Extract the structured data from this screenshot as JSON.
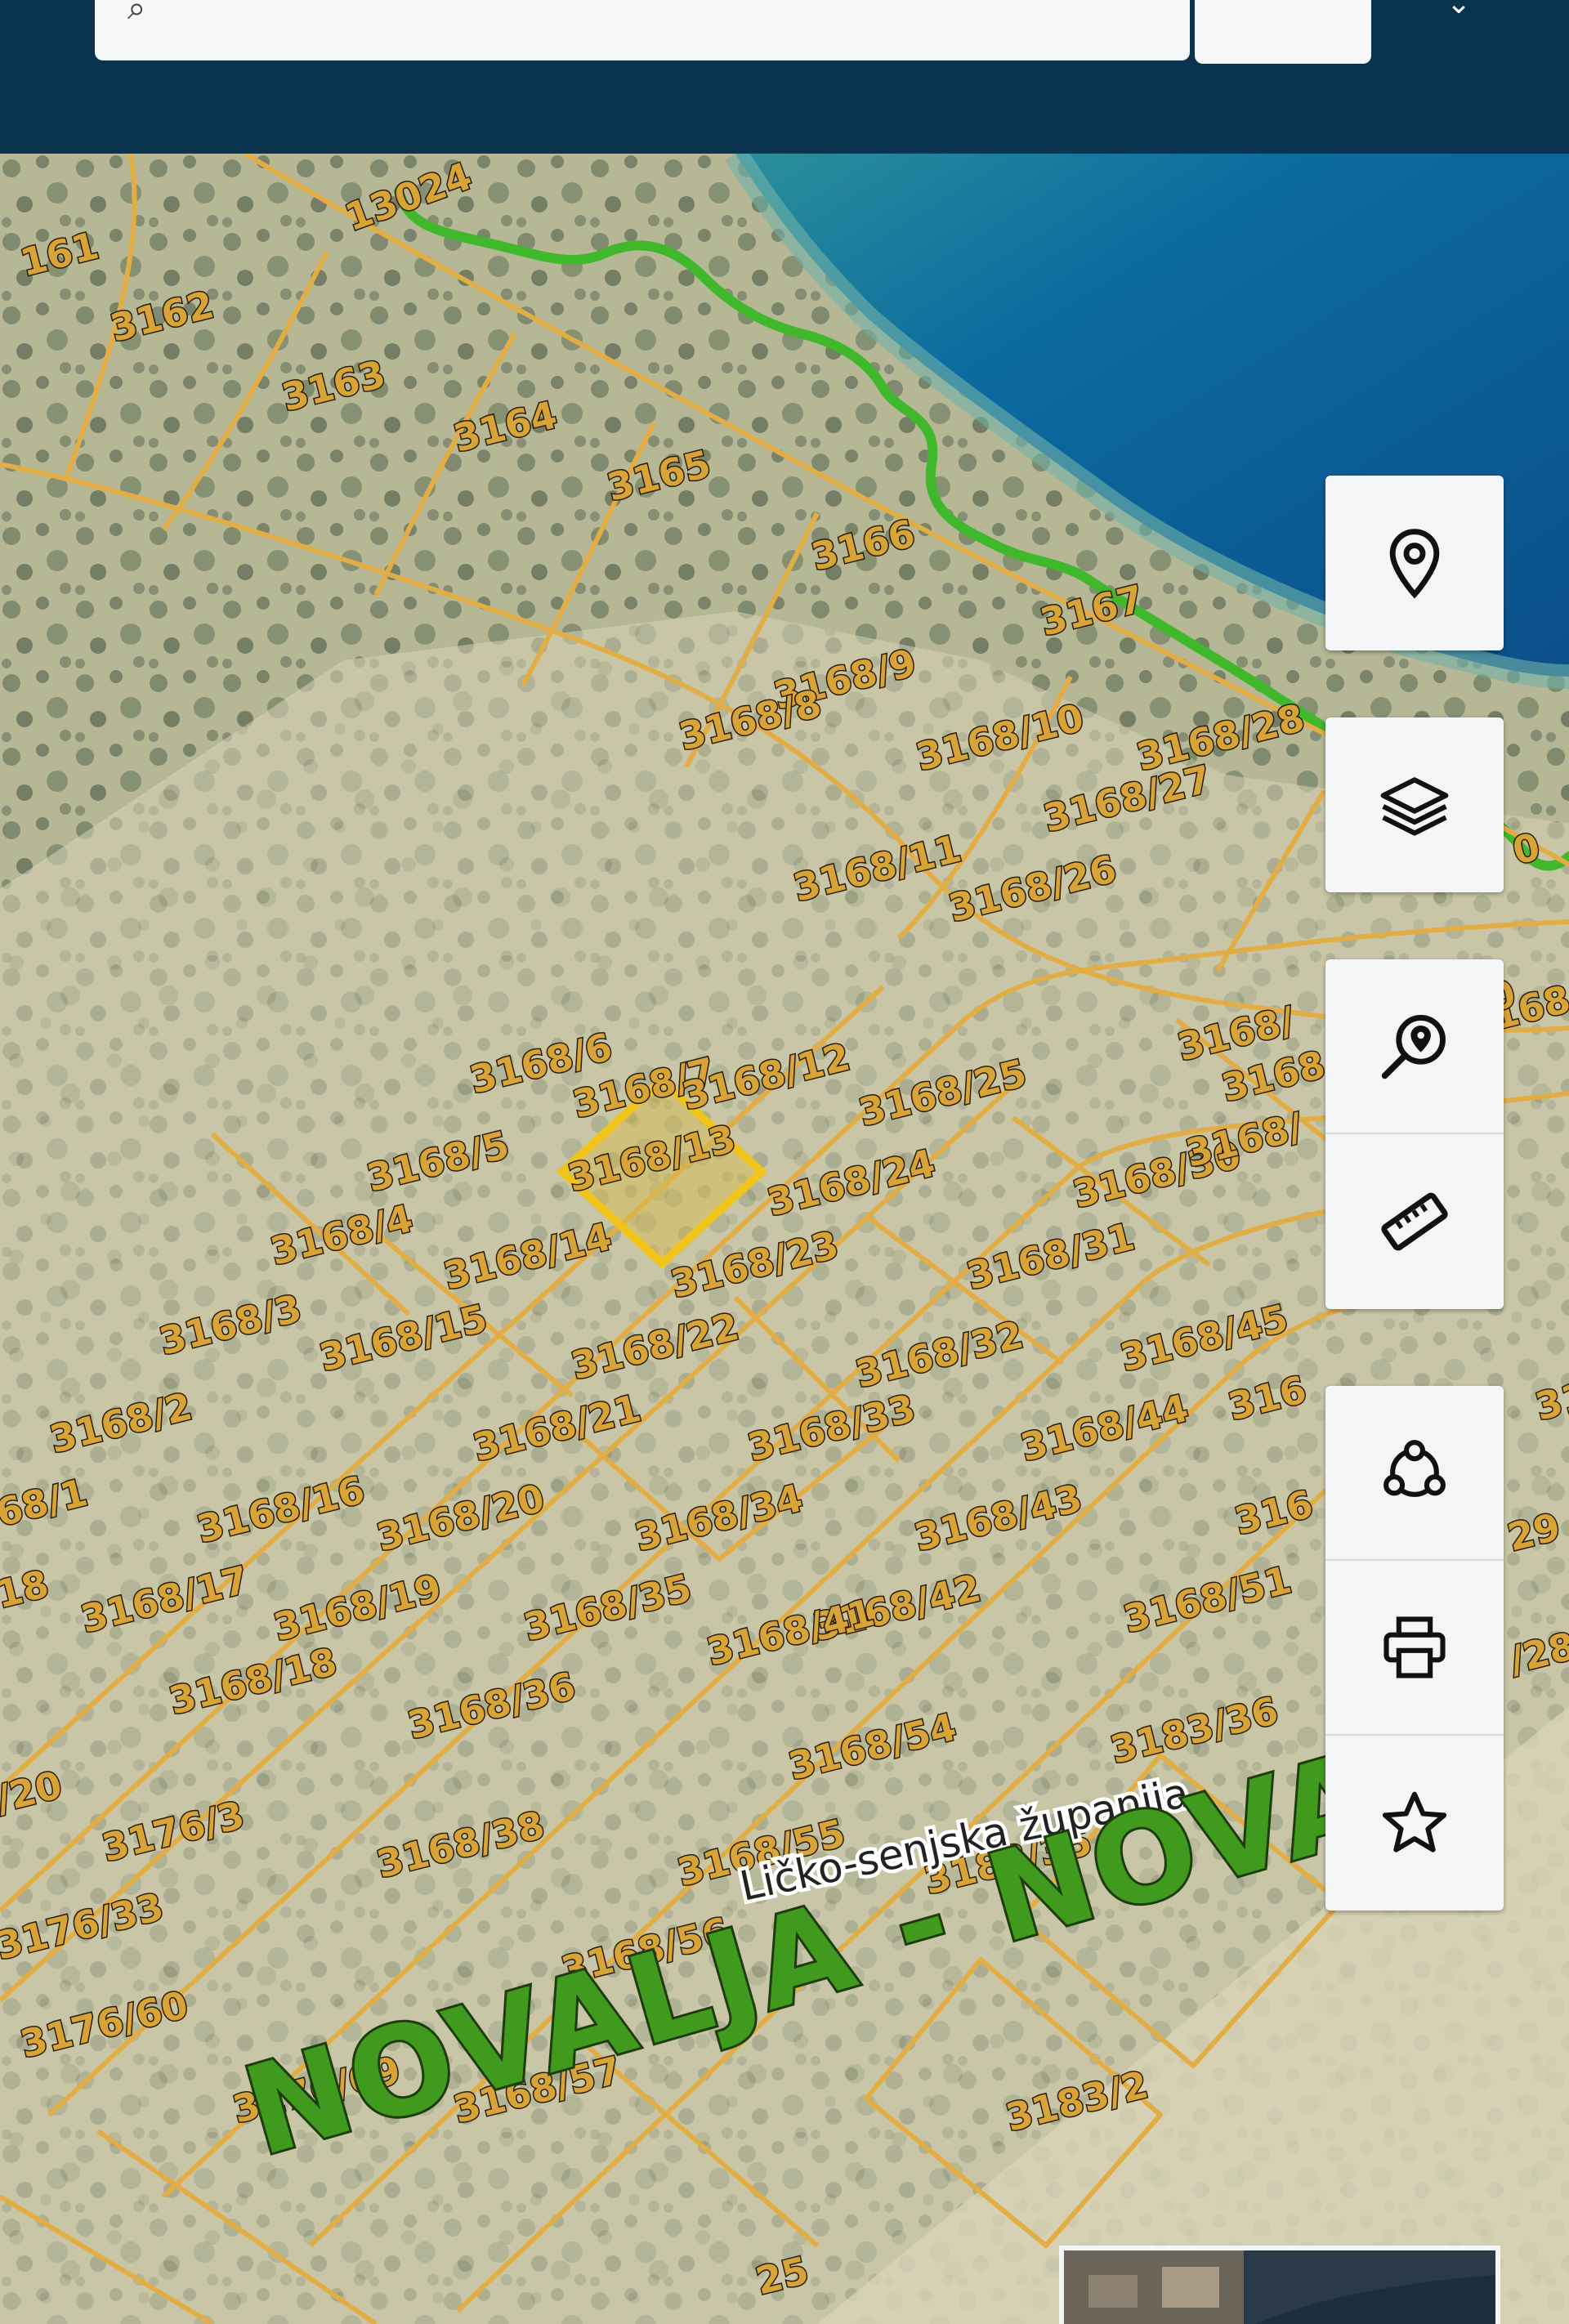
{
  "search": {
    "placeholder": ""
  },
  "icons": {
    "search": "search-icon",
    "menu": "chevron-icon",
    "location": "location-pin-icon",
    "layers": "layers-icon",
    "find_parcel": "search-location-icon",
    "measure": "ruler-icon",
    "share": "share-nodes-icon",
    "print": "printer-icon",
    "favorite": "star-icon"
  },
  "map": {
    "place_name": "NOVALJA - NOVA",
    "county_label": "Ličko-senjska županija",
    "highlighted_parcel": "3168/7",
    "parcels": [
      "161",
      "13024",
      "3162",
      "3163",
      "3164",
      "3165",
      "3166",
      "3167",
      "3168/9",
      "3168/8",
      "3168/7",
      "3168/10",
      "3168/28",
      "3168/27",
      "3168/11",
      "3168/26",
      "3168/6",
      "3168/12",
      "3168/25",
      "3168/5",
      "3168/13",
      "3168/24",
      "3168/30",
      "3168/4",
      "3168/14",
      "3168/23",
      "3168/31",
      "3168/3",
      "3168/15",
      "3168/22",
      "3168/32",
      "3168/45",
      "3168/2",
      "3168/21",
      "3168/33",
      "3168/44",
      "68/1",
      "3168/16",
      "3168/20",
      "3168/34",
      "3168/43",
      "18",
      "3168/17",
      "3168/19",
      "3168/35",
      "3168/42",
      "3168/51",
      "3168/41",
      "3168/18",
      "3168/36",
      "3168/54",
      "3183/36",
      "/20",
      "3176/3",
      "3168/38",
      "3168/55",
      "3183/35",
      "3176/33",
      "3168/56",
      "3176/60",
      "3176/69",
      "3168/57",
      "3183/2",
      "3168",
      "316",
      "31",
      "29",
      "/28",
      "316",
      "3168/",
      "3168/",
      "3168",
      "0",
      "0",
      "25"
    ]
  },
  "colors": {
    "header": "#0a3350",
    "sea": "#0b5e96",
    "coast_line": "#3fb82c",
    "parcel_line": "#e2ad45",
    "highlight": "#f0c419"
  }
}
